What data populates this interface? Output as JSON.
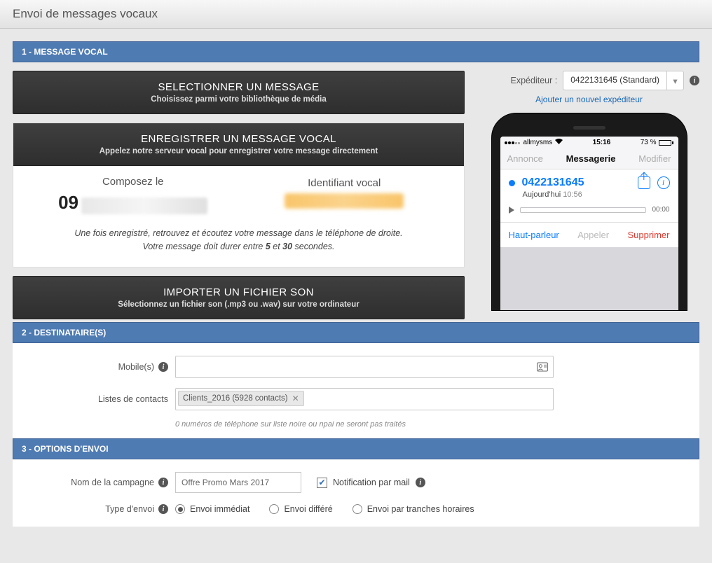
{
  "header": {
    "title": "Envoi de messages vocaux"
  },
  "sections": {
    "s1": "1 - MESSAGE VOCAL",
    "s2": "2 - DESTINATAIRE(S)",
    "s3": "3 - OPTIONS D'ENVOI"
  },
  "select_block": {
    "title": "SELECTIONNER UN MESSAGE",
    "sub": "Choisissez parmi votre bibliothèque de média"
  },
  "record_block": {
    "title": "ENREGISTRER UN MESSAGE VOCAL",
    "sub": "Appelez notre serveur vocal pour enregistrer votre message directement",
    "compose_label": "Composez le",
    "compose_prefix": "09",
    "id_label": "Identifiant vocal",
    "note_line1": "Une fois enregistré, retrouvez et écoutez votre message dans le téléphone de droite.",
    "note_line2a": "Votre message doit durer entre ",
    "note_b1": "5",
    "note_mid": " et ",
    "note_b2": "30",
    "note_line2b": " secondes."
  },
  "import_block": {
    "title": "IMPORTER UN FICHIER SON",
    "sub": "Sélectionnez un fichier son (.mp3 ou .wav) sur votre ordinateur"
  },
  "sender": {
    "label": "Expéditeur :",
    "value": "0422131645 (Standard)",
    "add_link": "Ajouter un nouvel expéditeur"
  },
  "phone": {
    "carrier": "allmysms",
    "time": "15:16",
    "battery": "73 %",
    "nav_left": "Annonce",
    "nav_center": "Messagerie",
    "nav_right": "Modifier",
    "number": "0422131645",
    "date_label": "Aujourd'hui",
    "date_time": "10:56",
    "duration": "00:00",
    "action_speaker": "Haut-parleur",
    "action_call": "Appeler",
    "action_delete": "Supprimer"
  },
  "destin": {
    "mobile_label": "Mobile(s)",
    "lists_label": "Listes de contacts",
    "tag": "Clients_2016 (5928 contacts)",
    "note": "0 numéros de téléphone sur liste noire ou npai ne seront pas traités"
  },
  "options": {
    "campaign_label": "Nom de la campagne",
    "campaign_value": "Offre Promo Mars 2017",
    "notify_label": "Notification par mail",
    "type_label": "Type d'envoi",
    "radio1": "Envoi immédiat",
    "radio2": "Envoi différé",
    "radio3": "Envoi par tranches horaires"
  }
}
